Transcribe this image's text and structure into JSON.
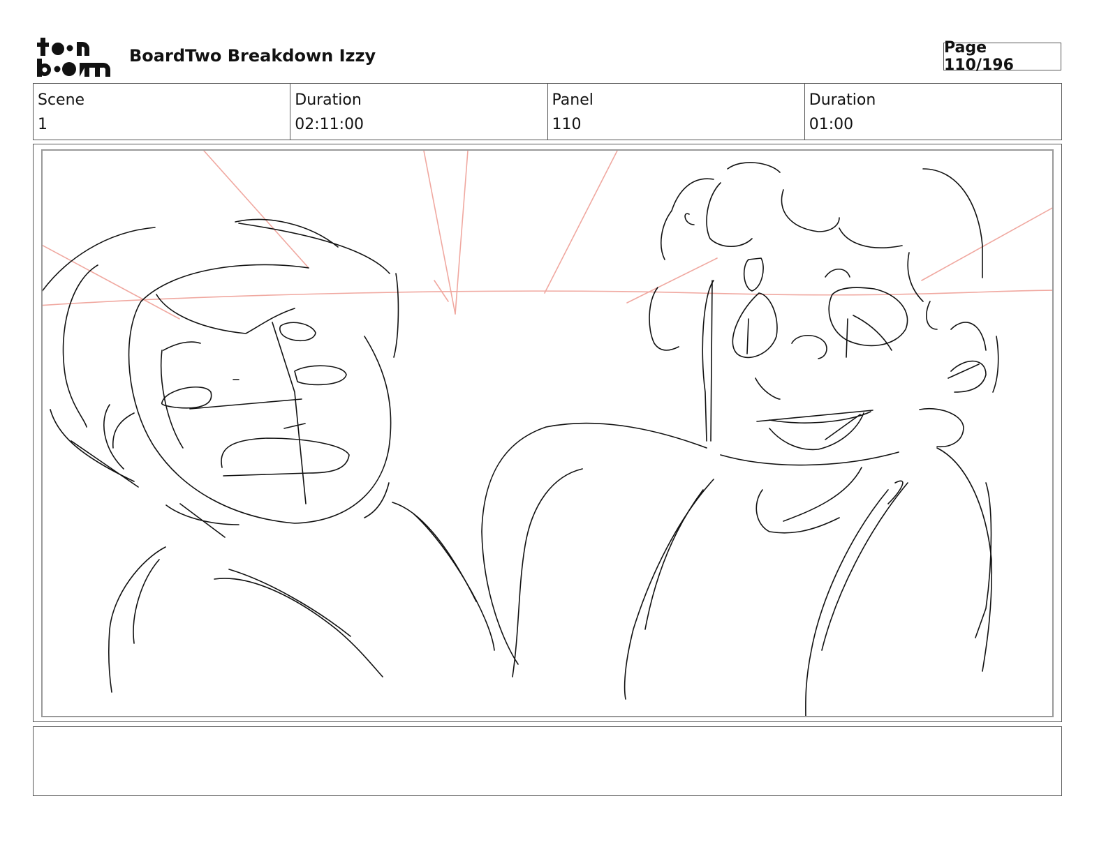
{
  "header": {
    "logo_text": "toon boom",
    "document_title": "BoardTwo Breakdown Izzy",
    "page_indicator": "Page 110/196"
  },
  "info": {
    "scene_label": "Scene",
    "scene_value": "1",
    "scene_duration_label": "Duration",
    "scene_duration_value": "02:11:00",
    "panel_label": "Panel",
    "panel_value": "110",
    "panel_duration_label": "Duration",
    "panel_duration_value": "01:00"
  },
  "panel": {
    "sketch_line_color": "#111111",
    "guide_line_color": "#f0a8a0"
  },
  "notes": {
    "text": ""
  }
}
